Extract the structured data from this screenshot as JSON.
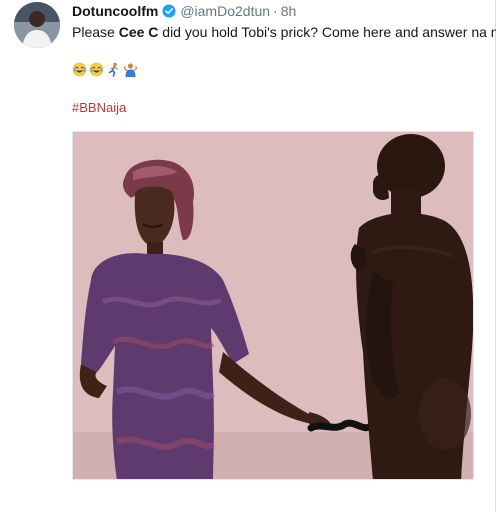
{
  "tweet": {
    "display_name": "Dotuncoolfm",
    "handle": "@iamDo2dtun",
    "separator": "·",
    "time": "8h",
    "verified_icon": "verified-badge-icon",
    "text_before": "Please ",
    "text_bold": "Cee C",
    "text_after": " did you hold Tobi's prick? Come here and answer na na",
    "emoji_icons": [
      "face-with-tears-of-joy",
      "face-with-tears-of-joy",
      "person-running",
      "person-shrugging"
    ],
    "hashtag": "#BBNaija"
  },
  "colors": {
    "name_text": "#14171a",
    "meta_text": "#657786",
    "hashtag": "#c0392b",
    "verified_blue": "#1da1f2",
    "media_wall": "#d9b7ba"
  }
}
